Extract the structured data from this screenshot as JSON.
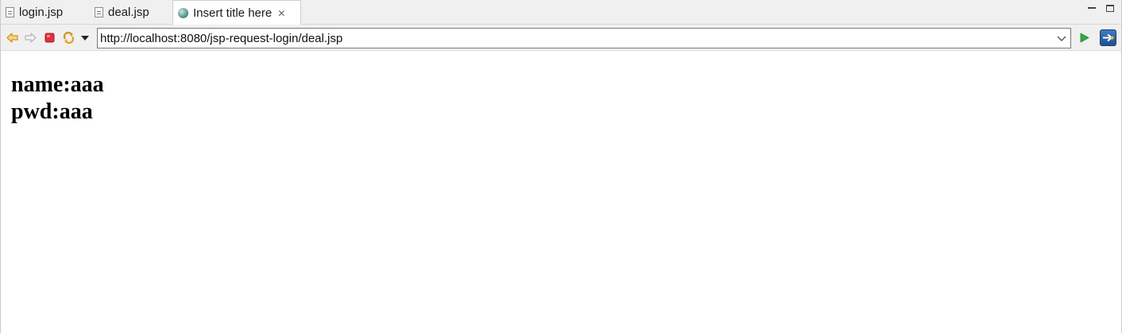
{
  "tabs": [
    {
      "label": "login.jsp",
      "icon": "jsp-file-icon",
      "active": false
    },
    {
      "label": "deal.jsp",
      "icon": "jsp-file-icon",
      "active": false
    },
    {
      "label": "Insert title here",
      "icon": "globe-icon",
      "active": true,
      "closable": true
    }
  ],
  "tab_close_glyph": "✕",
  "toolbar": {
    "url": "http://localhost:8080/jsp-request-login/deal.jsp",
    "buttons": [
      "back-icon",
      "forward-icon",
      "stop-icon",
      "refresh-icon",
      "dropdown-icon",
      "go-icon",
      "eclipse-icon"
    ]
  },
  "page": {
    "name_line": "name:aaa",
    "pwd_line": "pwd:aaa"
  },
  "colors": {
    "chrome_bg": "#f0f0f0",
    "stop_red": "#e0303a",
    "arrow_orange": "#e8a020",
    "go_green": "#3aa64a"
  }
}
